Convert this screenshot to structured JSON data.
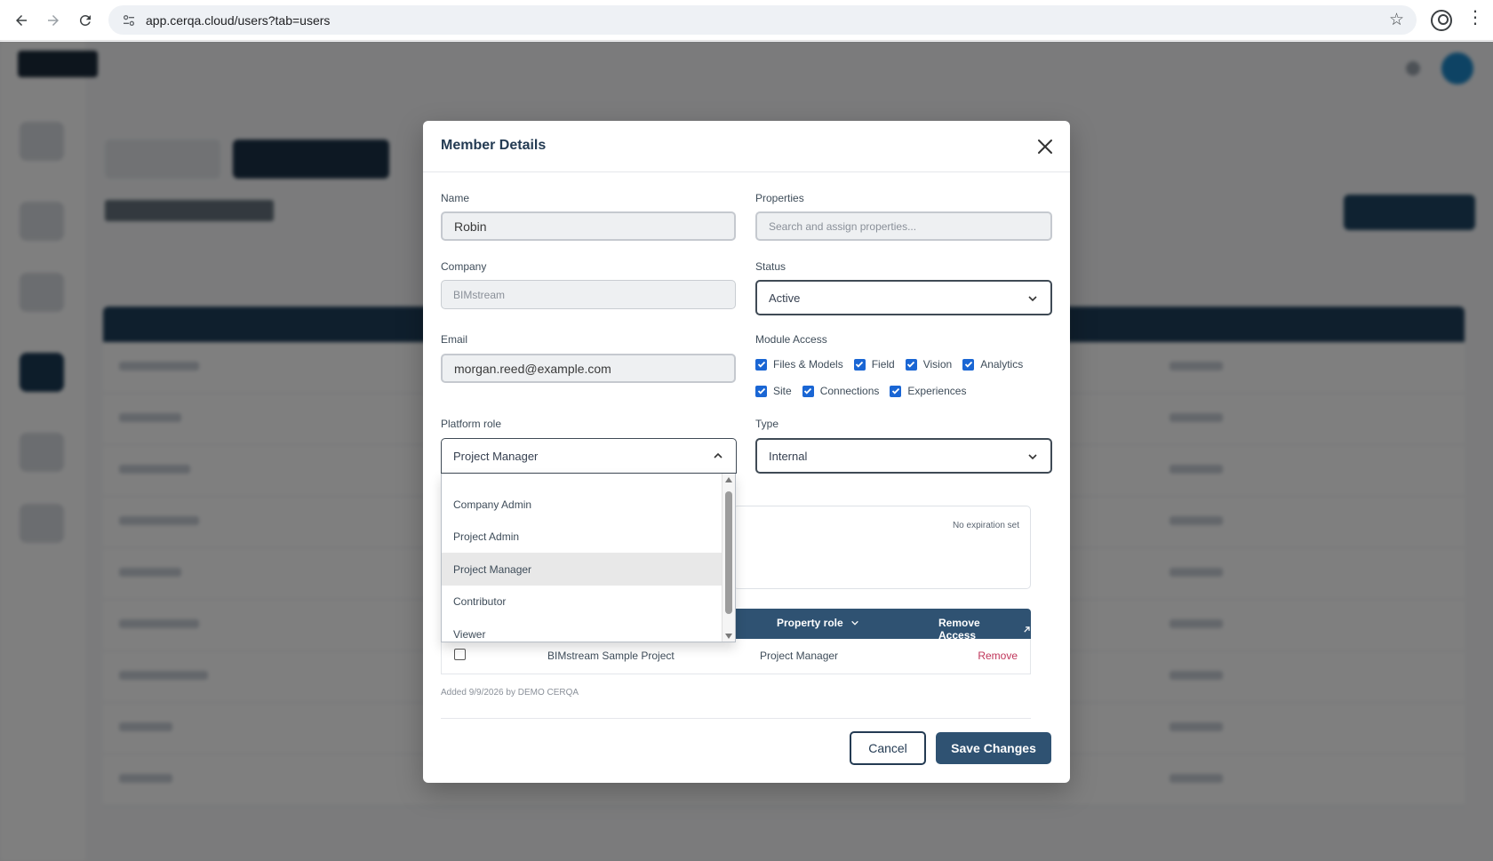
{
  "browser": {
    "url": "app.cerqa.cloud/users?tab=users",
    "back_icon": "arrow-left-icon",
    "forward_icon": "arrow-right-icon",
    "reload_icon": "reload-icon",
    "site_info_icon": "tune-icon",
    "bookmark_icon": "star-icon",
    "profile_icon": "account-circle-icon",
    "menu_icon": "kebab-menu-icon"
  },
  "modal": {
    "title": "Member Details",
    "close_icon": "close-icon",
    "name": {
      "label": "Name",
      "value": "Robin"
    },
    "properties": {
      "label": "Properties",
      "placeholder": "Search and assign properties..."
    },
    "company": {
      "label": "Company",
      "value": "BIMstream"
    },
    "status": {
      "label": "Status",
      "value": "Active"
    },
    "email": {
      "label": "Email",
      "value": "morgan.reed@example.com"
    },
    "module_access": {
      "label": "Module Access",
      "row1": [
        "Files & Models",
        "Field",
        "Vision",
        "Analytics"
      ],
      "row2": [
        "Site",
        "Connections",
        "Experiences"
      ]
    },
    "platform_role": {
      "label": "Platform role",
      "value": "Project Manager",
      "options": [
        "Company Admin",
        "Project Admin",
        "Project Manager",
        "Contributor",
        "Viewer"
      ],
      "selected_index": 2
    },
    "type": {
      "label": "Type",
      "value": "Internal"
    },
    "expiration": {
      "text": "No expiration set"
    },
    "properties_table": {
      "col_role": "Property role",
      "col_remove": "Remove Access",
      "rows": [
        {
          "property": "BIMstream Sample Project",
          "role": "Project Manager",
          "action": "Remove"
        }
      ]
    },
    "added_text": "Added 9/9/2026 by DEMO CERQA",
    "cancel_label": "Cancel",
    "save_label": "Save Changes"
  },
  "colors": {
    "primary": "#2f5272",
    "title": "#243b53",
    "danger": "#c0355a",
    "checkbox": "#1a66d4"
  }
}
